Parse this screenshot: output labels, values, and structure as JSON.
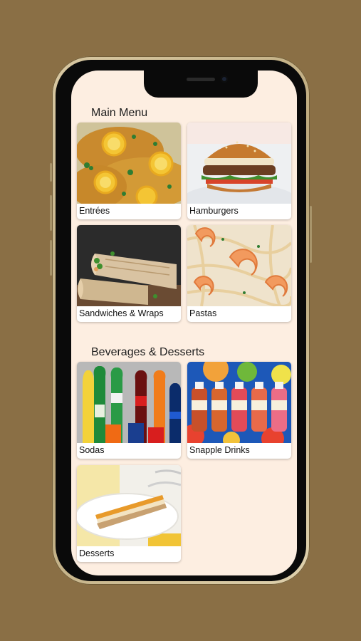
{
  "sections": [
    {
      "title": "Main Menu",
      "items": [
        {
          "label": "Entrées"
        },
        {
          "label": "Hamburgers"
        },
        {
          "label": "Sandwiches & Wraps"
        },
        {
          "label": "Pastas"
        }
      ]
    },
    {
      "title": "Beverages & Desserts",
      "items": [
        {
          "label": "Sodas"
        },
        {
          "label": "Snapple Drinks"
        },
        {
          "label": "Desserts"
        }
      ]
    }
  ],
  "colors": {
    "background": "#8a6f45",
    "screen": "#fdeee1",
    "card": "#ffffff",
    "text": "#1e1e1e"
  }
}
